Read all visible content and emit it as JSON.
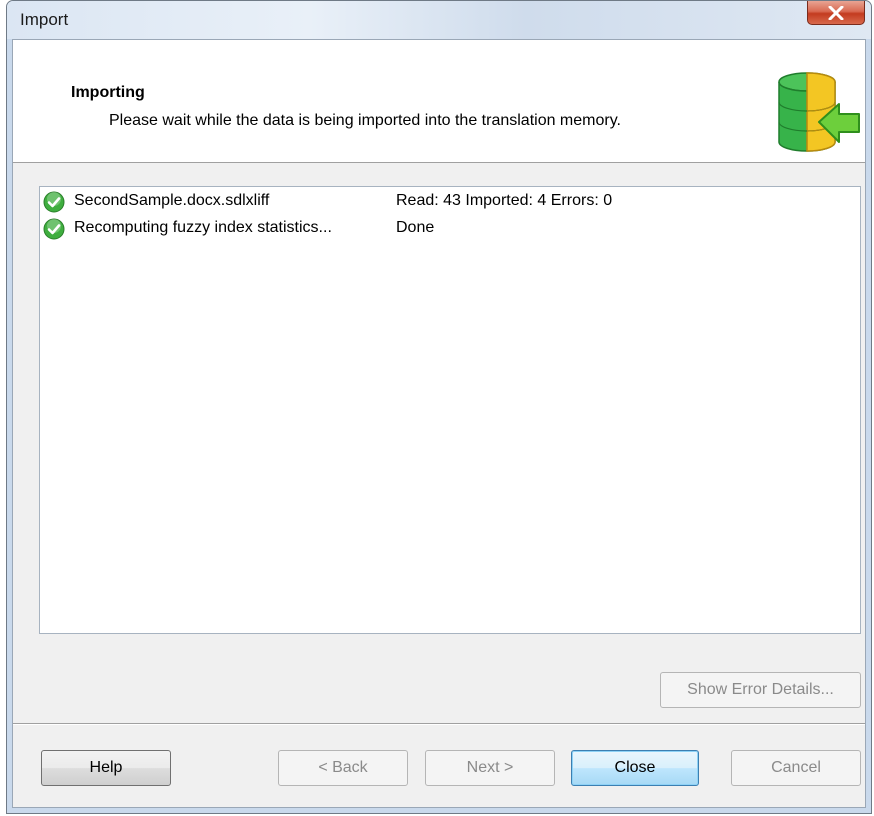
{
  "window": {
    "title": "Import",
    "close_glyph": "X"
  },
  "header": {
    "title": "Importing",
    "subtitle": "Please wait while the data is being imported into the translation memory.",
    "icon": "database-import-icon"
  },
  "list": {
    "rows": [
      {
        "name": "SecondSample.docx.sdlxliff",
        "status": "Read: 43 Imported: 4 Errors: 0",
        "icon": "check-circle-icon"
      },
      {
        "name": "Recomputing fuzzy index statistics...",
        "status": "Done",
        "icon": "check-circle-icon"
      }
    ]
  },
  "buttons": {
    "show_error_details": "Show Error Details...",
    "help": "Help",
    "back": "< Back",
    "next": "Next >",
    "close": "Close",
    "cancel": "Cancel"
  },
  "colors": {
    "success_green": "#3fae3f",
    "db_yellow": "#f3c623",
    "db_green": "#37b34a",
    "arrow_green": "#6dcf3c",
    "titlebar_close_red": "#c84a2f"
  }
}
